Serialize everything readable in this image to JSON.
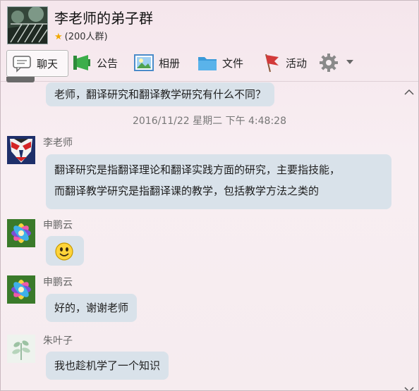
{
  "group": {
    "name": "李老师的弟子群",
    "member_count": "(200人群)"
  },
  "toolbar": {
    "items": [
      {
        "label": "聊天",
        "icon": "chat-bubble-icon"
      },
      {
        "label": "公告",
        "icon": "megaphone-icon"
      },
      {
        "label": "相册",
        "icon": "photo-icon"
      },
      {
        "label": "文件",
        "icon": "folder-icon"
      },
      {
        "label": "活动",
        "icon": "flag-icon"
      }
    ],
    "settings_icon": "gear-icon"
  },
  "messages": {
    "m0": {
      "text": "老师，翻译研究和翻译教学研究有什么不同？"
    },
    "timestamp": "2016/11/22 星期二 下午 4:48:28",
    "m1": {
      "sender": "李老师",
      "line1": "翻译研究是指翻译理论和翻译实践方面的研究，主要指技能，",
      "line2": "而翻译教学研究是指翻译课的教学，包括教学方法之类的"
    },
    "m2": {
      "sender": "申鹏云",
      "content_icon": "smiley-emoji-icon"
    },
    "m3": {
      "sender": "申鹏云",
      "text": "好的，谢谢老师"
    },
    "m4": {
      "sender": "朱叶子",
      "text": "我也趁机学了一个知识"
    }
  },
  "colors": {
    "bubble": "#d9e2ea",
    "background": "#f7eef1",
    "accent_folder": "#3a9ad9",
    "accent_flag": "#d23a3a"
  }
}
